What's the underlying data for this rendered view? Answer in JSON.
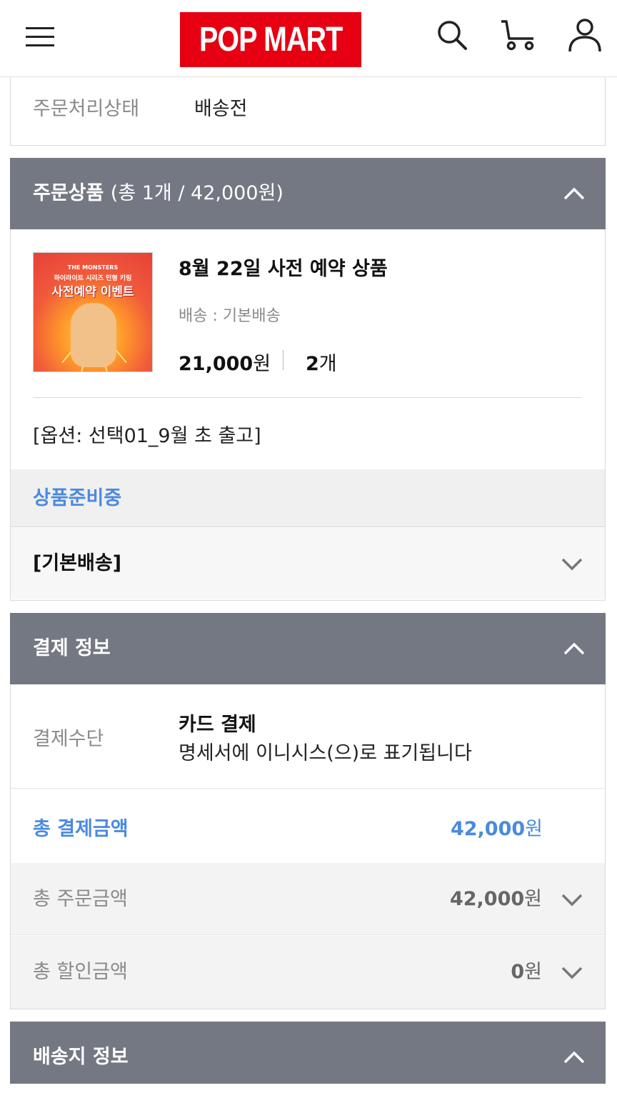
{
  "header": {
    "logo_text": "POP MART",
    "icons": [
      "menu-icon",
      "search-icon",
      "cart-icon",
      "user-icon"
    ]
  },
  "order_status": {
    "label": "주문처리상태",
    "value": "배송전"
  },
  "order_items": {
    "title": "주문상품",
    "summary": "(총 1개 / 42,000원)",
    "product": {
      "image_text_line1": "THE MONSTERS",
      "image_text_line2": "하이라이트 시리즈 인형 키링",
      "image_text_line3": "사전예약 이벤트",
      "name": "8월 22일 사전 예약 상품",
      "shipping": "배송 : 기본배송",
      "price_number": "21,000",
      "price_unit": "원",
      "qty_number": "2",
      "qty_unit": "개",
      "option": "[옵션: 선택01_9월 초 출고]"
    },
    "status": "상품준비중",
    "shipping_type": "[기본배송]"
  },
  "payment": {
    "title": "결제 정보",
    "method_label": "결제수단",
    "method_value": "카드 결제",
    "method_note": "명세서에 이니시스(으)로 표기됩니다",
    "total_label": "총 결제금액",
    "total_number": "42,000",
    "total_unit": "원",
    "order_total_label": "총 주문금액",
    "order_total_number": "42,000",
    "order_total_unit": "원",
    "discount_label": "총 할인금액",
    "discount_number": "0",
    "discount_unit": "원"
  },
  "delivery": {
    "title": "배송지 정보"
  },
  "colors": {
    "brand_red": "#e60012",
    "section_header": "#747882",
    "accent_blue": "#4a8ae0"
  }
}
